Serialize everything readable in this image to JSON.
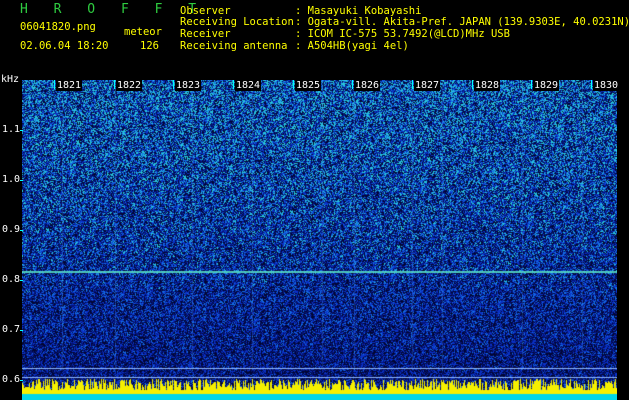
{
  "header": {
    "station": "H R O F F T",
    "filename": "06041820.png",
    "datetime": "02.06.04 18:20",
    "count_label": "meteor",
    "count_value": "126"
  },
  "info": [
    {
      "label": "Observer",
      "value": ": Masayuki Kobayashi"
    },
    {
      "label": "Receiving Location",
      "value": ": Ogata-vill. Akita-Pref. JAPAN (139.9303E, 40.0231N)"
    },
    {
      "label": "Receiver",
      "value": ": ICOM IC-575 53.7492(@LCD)MHz USB"
    },
    {
      "label": "Receiving antenna",
      "value": ": A504HB(yagi 4el)"
    }
  ],
  "axis": {
    "y_unit": "kHz",
    "y_ticks": [
      "1.1",
      "1.0",
      "0.9",
      "0.8",
      "0.7",
      "0.6"
    ],
    "x_ticks": [
      "1821",
      "1822",
      "1823",
      "1824",
      "1825",
      "1826",
      "1827",
      "1828",
      "1829",
      "1830"
    ]
  },
  "colors": {
    "title": "#2ecc40",
    "meta": "#ffff00",
    "labels": "#ffffff",
    "axis": "#00ffff",
    "background": "#000000"
  }
}
